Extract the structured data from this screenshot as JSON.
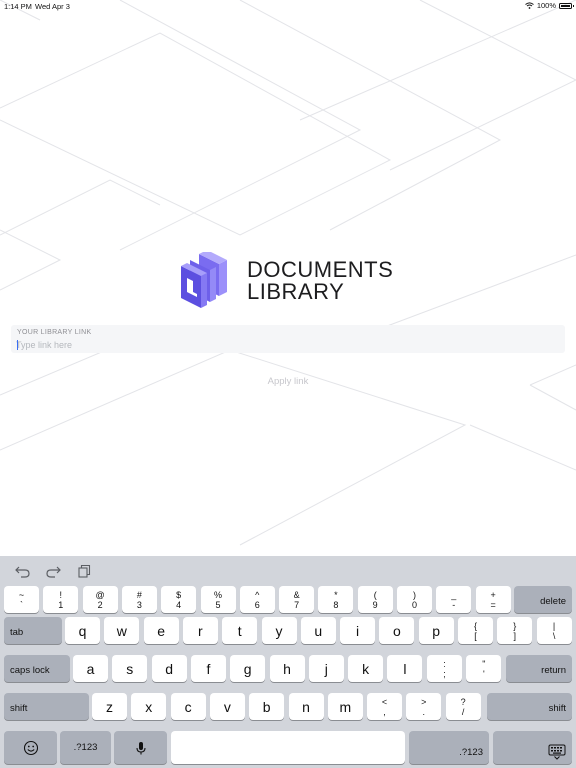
{
  "status_bar": {
    "time": "1:14 PM",
    "date": "Wed Apr 3",
    "battery": "100%"
  },
  "brand": {
    "line1": "DOCUMENTS",
    "line2": "LIBRARY"
  },
  "link_field": {
    "label": "YOUR LIBRARY LINK",
    "placeholder": "Type link here",
    "value": ""
  },
  "apply_label": "Apply link",
  "keyboard": {
    "number_row": [
      [
        "~",
        "`"
      ],
      [
        "!",
        "1"
      ],
      [
        "@",
        "2"
      ],
      [
        "#",
        "3"
      ],
      [
        "$",
        "4"
      ],
      [
        "%",
        "5"
      ],
      [
        "^",
        "6"
      ],
      [
        "&",
        "7"
      ],
      [
        "*",
        "8"
      ],
      [
        "(",
        "9"
      ],
      [
        ")",
        "0"
      ],
      [
        "_",
        "-"
      ],
      [
        "+",
        "="
      ]
    ],
    "delete": "delete",
    "tab": "tab",
    "row_qwerty": [
      "q",
      "w",
      "e",
      "r",
      "t",
      "y",
      "u",
      "i",
      "o",
      "p"
    ],
    "row_qwerty_punct": [
      [
        "{",
        "["
      ],
      [
        "}",
        "]"
      ],
      [
        "|",
        "\\"
      ]
    ],
    "caps_lock": "caps lock",
    "row_home": [
      "a",
      "s",
      "d",
      "f",
      "g",
      "h",
      "j",
      "k",
      "l"
    ],
    "row_home_punct": [
      [
        ":",
        ";"
      ],
      [
        "\"",
        "'"
      ]
    ],
    "return": "return",
    "shift": "shift",
    "row_bottom": [
      "z",
      "x",
      "c",
      "v",
      "b",
      "n",
      "m"
    ],
    "row_bottom_punct": [
      [
        "<",
        ","
      ],
      [
        ">",
        "."
      ],
      [
        "?",
        "/"
      ]
    ],
    "numbers_key": ".?123"
  }
}
